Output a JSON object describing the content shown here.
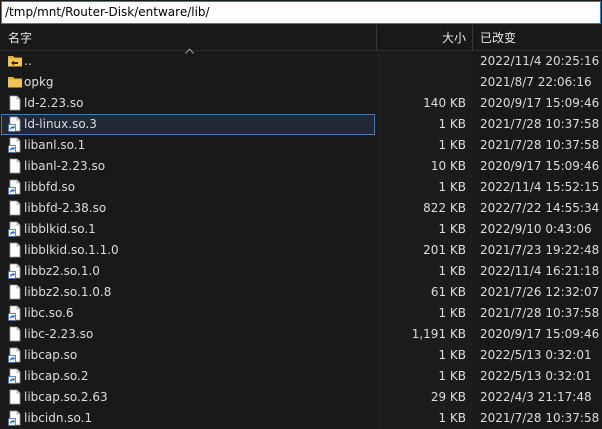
{
  "pathbar": {
    "path": "/tmp/mnt/Router-Disk/entware/lib/"
  },
  "header": {
    "name": "名字",
    "size": "大小",
    "modified": "已改变"
  },
  "files": [
    {
      "name": "..",
      "size": "",
      "date": "2022/11/4 20:25:16",
      "icon": "parent-folder-icon",
      "selected": false
    },
    {
      "name": "opkg",
      "size": "",
      "date": "2021/8/7 22:06:16",
      "icon": "folder-icon",
      "selected": false
    },
    {
      "name": "ld-2.23.so",
      "size": "140 KB",
      "date": "2020/9/17 15:09:46",
      "icon": "file-icon",
      "selected": false
    },
    {
      "name": "ld-linux.so.3",
      "size": "1 KB",
      "date": "2021/7/28 10:37:58",
      "icon": "shortcut-file-icon",
      "selected": true
    },
    {
      "name": "libanl.so.1",
      "size": "1 KB",
      "date": "2021/7/28 10:37:58",
      "icon": "shortcut-file-icon",
      "selected": false
    },
    {
      "name": "libanl-2.23.so",
      "size": "10 KB",
      "date": "2020/9/17 15:09:46",
      "icon": "file-icon",
      "selected": false
    },
    {
      "name": "libbfd.so",
      "size": "1 KB",
      "date": "2022/11/4 15:52:15",
      "icon": "shortcut-file-icon",
      "selected": false
    },
    {
      "name": "libbfd-2.38.so",
      "size": "822 KB",
      "date": "2022/7/22 14:55:34",
      "icon": "file-icon",
      "selected": false
    },
    {
      "name": "libblkid.so.1",
      "size": "1 KB",
      "date": "2022/9/10 0:43:06",
      "icon": "shortcut-file-icon",
      "selected": false
    },
    {
      "name": "libblkid.so.1.1.0",
      "size": "201 KB",
      "date": "2021/7/23 19:22:48",
      "icon": "file-icon",
      "selected": false
    },
    {
      "name": "libbz2.so.1.0",
      "size": "1 KB",
      "date": "2022/11/4 16:21:18",
      "icon": "shortcut-file-icon",
      "selected": false
    },
    {
      "name": "libbz2.so.1.0.8",
      "size": "61 KB",
      "date": "2021/7/26 12:32:07",
      "icon": "file-icon",
      "selected": false
    },
    {
      "name": "libc.so.6",
      "size": "1 KB",
      "date": "2021/7/28 10:37:58",
      "icon": "shortcut-file-icon",
      "selected": false
    },
    {
      "name": "libc-2.23.so",
      "size": "1,191 KB",
      "date": "2020/9/17 15:09:46",
      "icon": "file-icon",
      "selected": false
    },
    {
      "name": "libcap.so",
      "size": "1 KB",
      "date": "2022/5/13 0:32:01",
      "icon": "shortcut-file-icon",
      "selected": false
    },
    {
      "name": "libcap.so.2",
      "size": "1 KB",
      "date": "2022/5/13 0:32:01",
      "icon": "shortcut-file-icon",
      "selected": false
    },
    {
      "name": "libcap.so.2.63",
      "size": "29 KB",
      "date": "2022/4/3 21:17:48",
      "icon": "file-icon",
      "selected": false
    },
    {
      "name": "libcidn.so.1",
      "size": "1 KB",
      "date": "2021/7/28 10:37:58",
      "icon": "shortcut-file-icon",
      "selected": false
    }
  ],
  "colors": {
    "background": "#191919",
    "size_column": "#1c1c1c",
    "folder": "#e8b13c",
    "selection_border": "#4a7ab0",
    "path_border": "#2f7fd0"
  }
}
